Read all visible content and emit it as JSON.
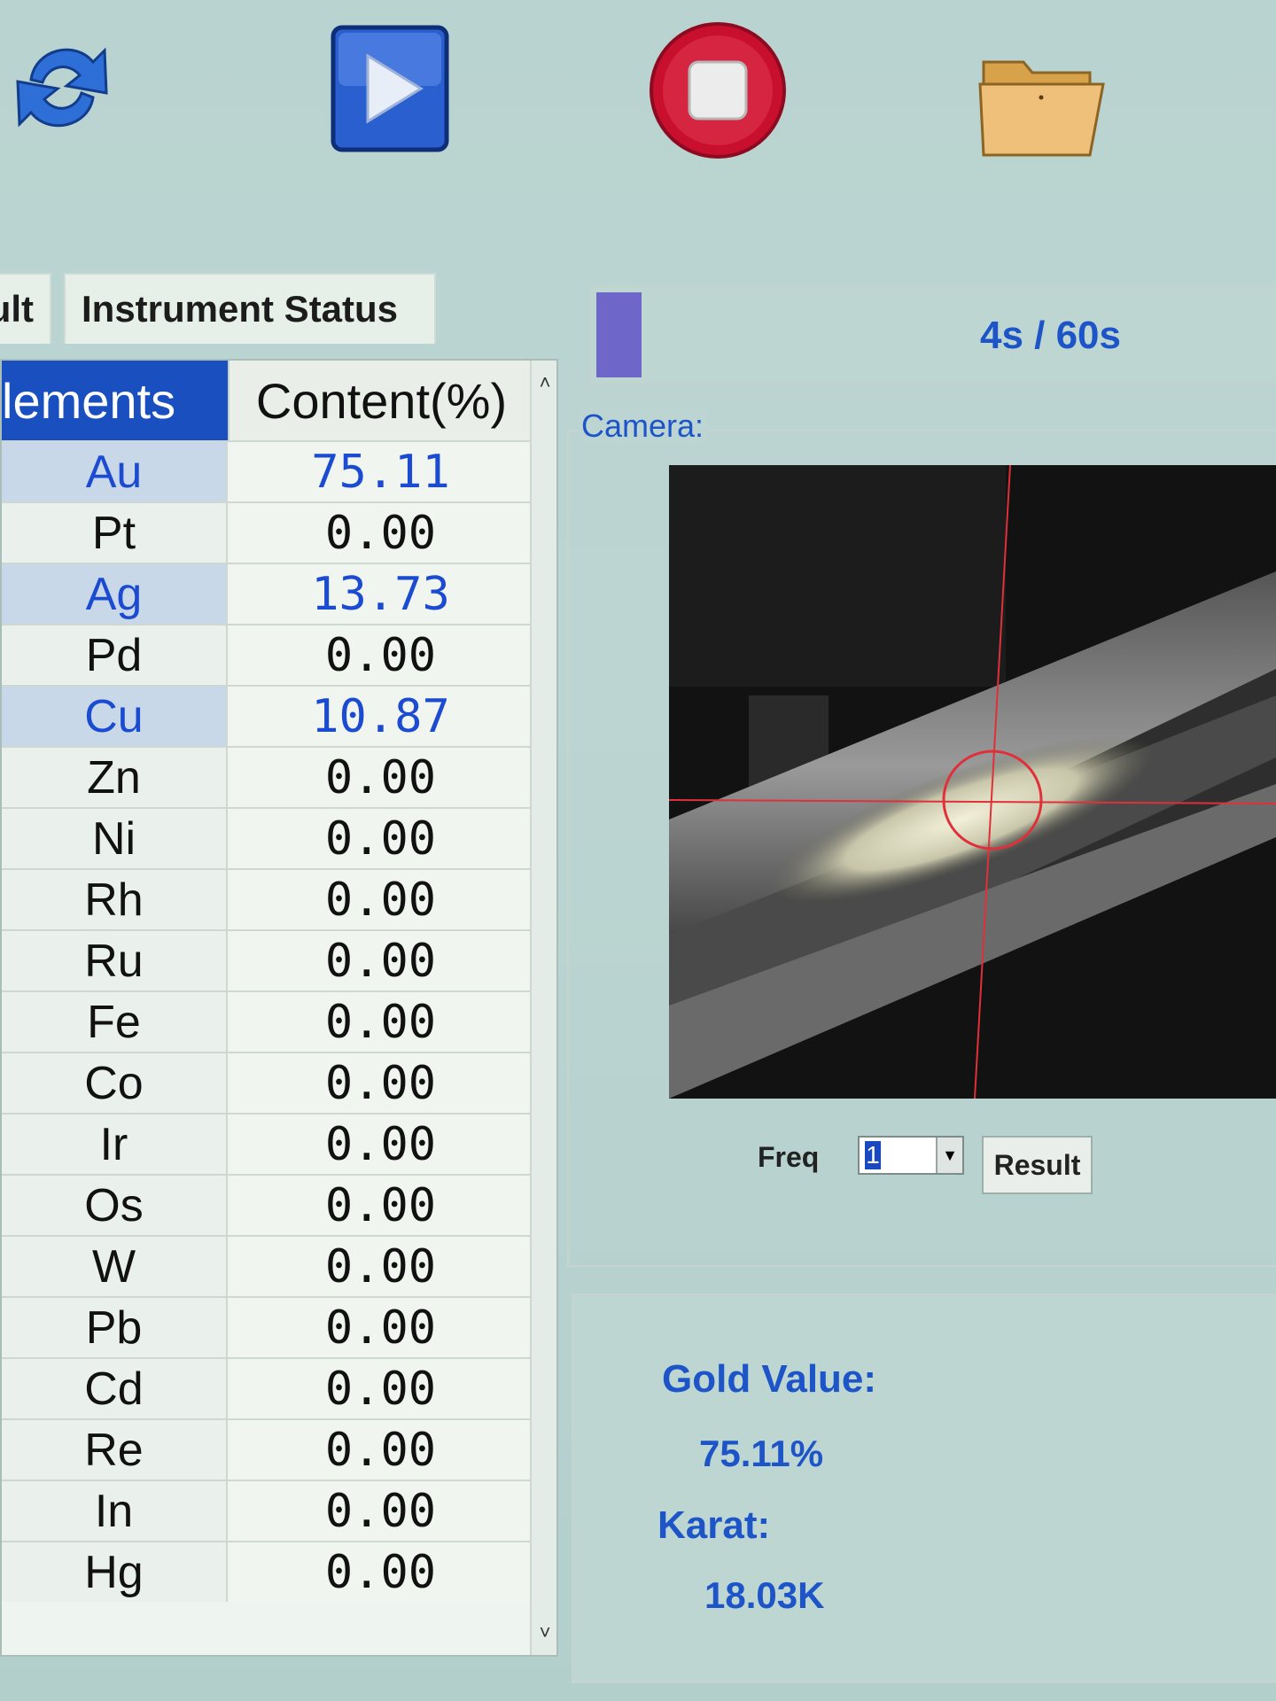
{
  "toolbar": {
    "refresh_icon": "refresh-icon",
    "start_icon": "play-icon",
    "stop_icon": "stop-icon",
    "open_icon": "folder-icon"
  },
  "tabs": {
    "result": "ult",
    "instrument_status": "Instrument Status"
  },
  "table": {
    "header_elements": "lements",
    "header_content": "Content(%)",
    "rows": [
      {
        "element": "Au",
        "content": "75.11"
      },
      {
        "element": "Pt",
        "content": "0.00"
      },
      {
        "element": "Ag",
        "content": "13.73"
      },
      {
        "element": "Pd",
        "content": "0.00"
      },
      {
        "element": "Cu",
        "content": "10.87"
      },
      {
        "element": "Zn",
        "content": "0.00"
      },
      {
        "element": "Ni",
        "content": "0.00"
      },
      {
        "element": "Rh",
        "content": "0.00"
      },
      {
        "element": "Ru",
        "content": "0.00"
      },
      {
        "element": "Fe",
        "content": "0.00"
      },
      {
        "element": "Co",
        "content": "0.00"
      },
      {
        "element": "Ir",
        "content": "0.00"
      },
      {
        "element": "Os",
        "content": "0.00"
      },
      {
        "element": "W",
        "content": "0.00"
      },
      {
        "element": "Pb",
        "content": "0.00"
      },
      {
        "element": "Cd",
        "content": "0.00"
      },
      {
        "element": "Re",
        "content": "0.00"
      },
      {
        "element": "In",
        "content": "0.00"
      },
      {
        "element": "Hg",
        "content": "0.00"
      }
    ]
  },
  "progress": {
    "text": "4s / 60s",
    "fraction": 0.0667
  },
  "camera": {
    "label": "Camera:",
    "freq_label": "Freq",
    "freq_value": "1",
    "result_button": "Result"
  },
  "result": {
    "gold_label": "Gold Value:",
    "gold_value": "75.11%",
    "karat_label": "Karat:",
    "karat_value": "18.03K"
  },
  "colors": {
    "accent_blue": "#1d55c8",
    "header_blue": "#1a4fbf",
    "stop_red": "#c8102e",
    "crosshair_red": "#e0303a"
  }
}
